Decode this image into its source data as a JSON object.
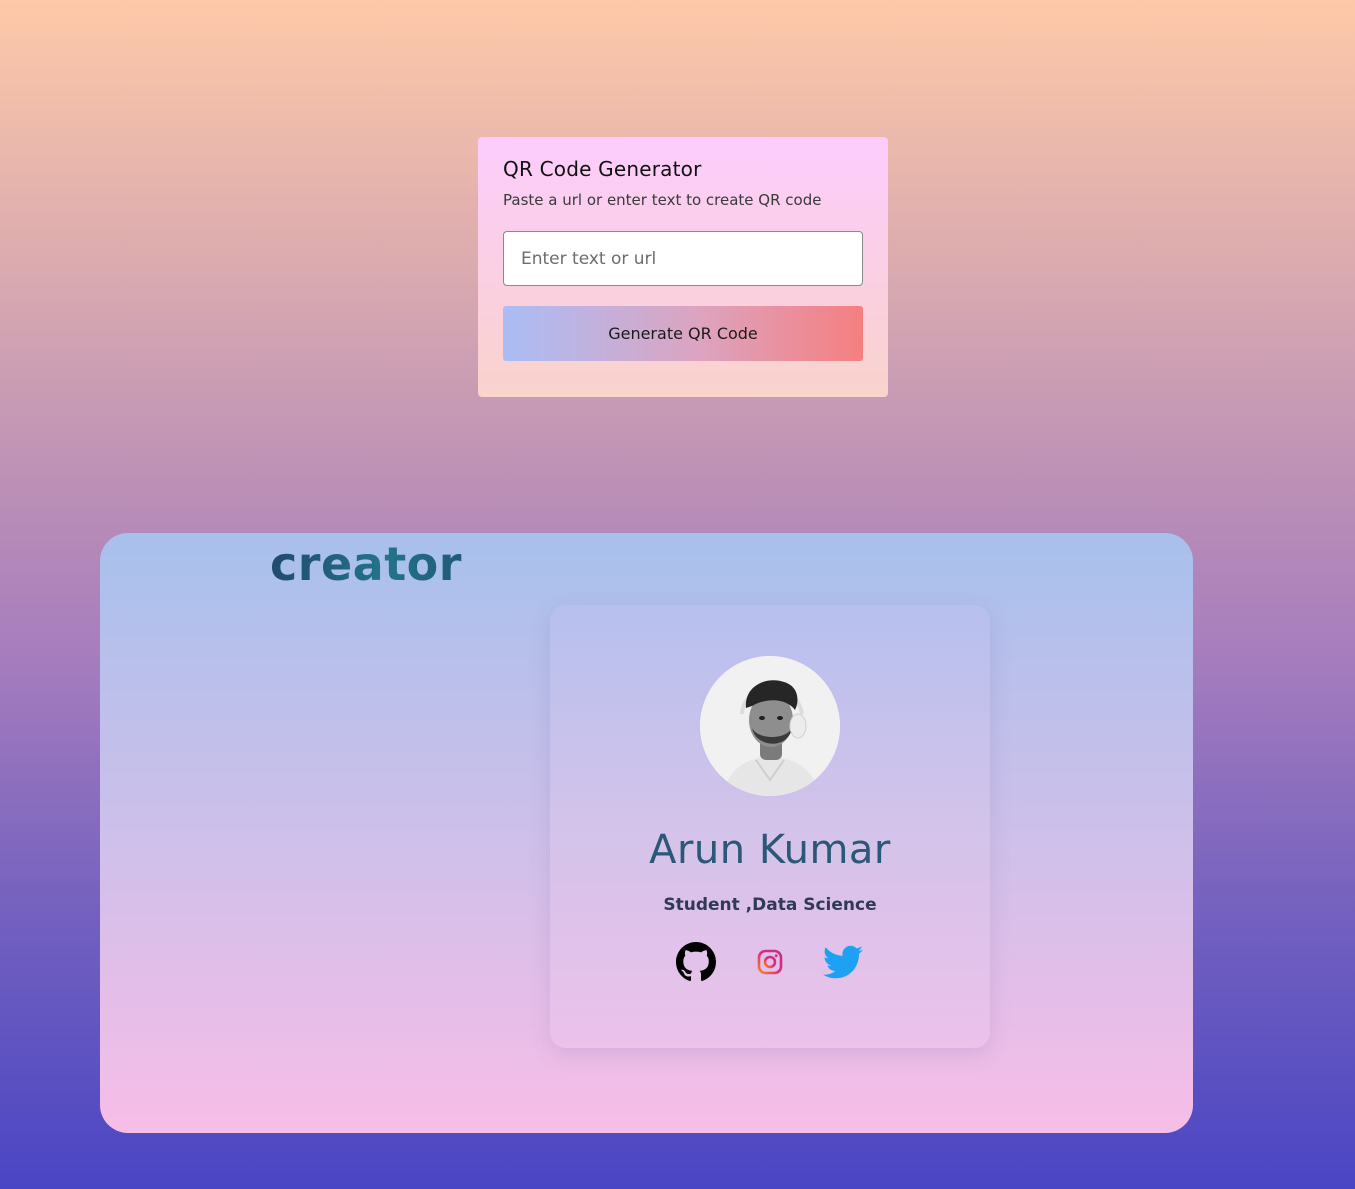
{
  "qr_generator": {
    "title": "QR Code Generator",
    "subtitle": "Paste a url or enter text to create QR code",
    "input_placeholder": "Enter text or url",
    "input_value": "",
    "button_label": "Generate QR Code"
  },
  "creator": {
    "heading": "creator",
    "profile": {
      "name": "Arun Kumar",
      "role": "Student ,Data Science",
      "avatar_icon": "profile-photo",
      "socials": [
        {
          "icon": "github-icon",
          "color": "#000000"
        },
        {
          "icon": "instagram-icon",
          "color": "#e1306c"
        },
        {
          "icon": "twitter-icon",
          "color": "#1da1f2"
        }
      ]
    }
  },
  "colors": {
    "accent_name": "#2a5876",
    "twitter": "#1da1f2",
    "instagram_start": "#f58529",
    "instagram_end": "#dd2a7b"
  }
}
